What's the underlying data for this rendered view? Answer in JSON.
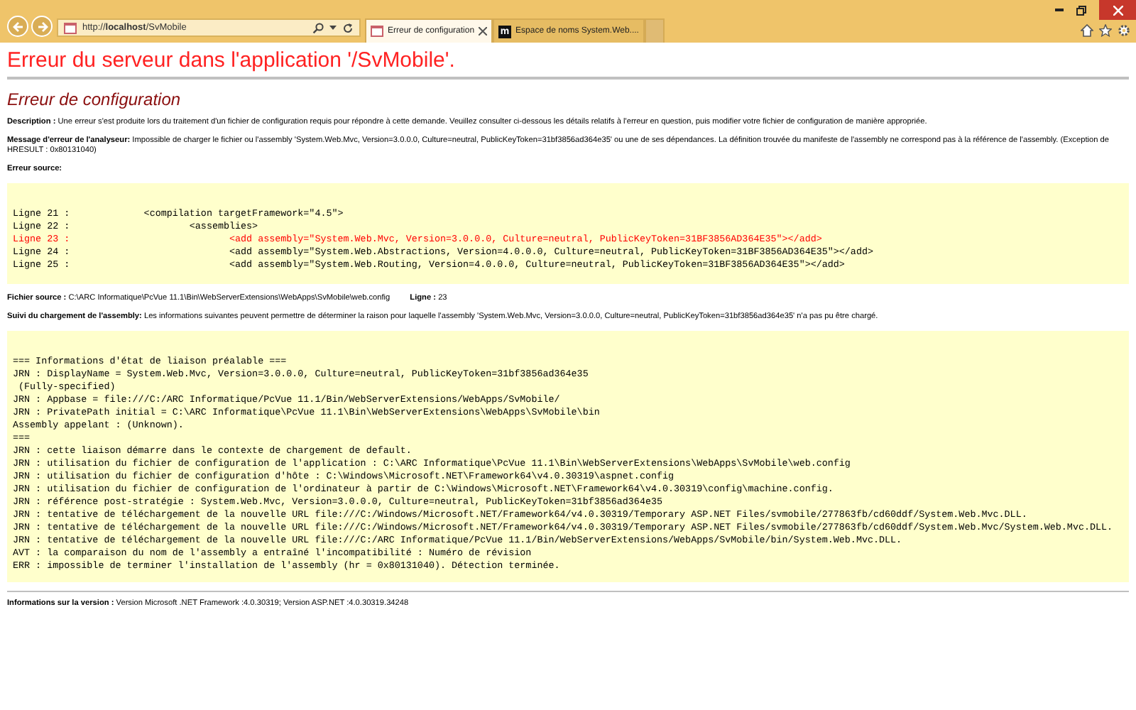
{
  "browser": {
    "address": "http://**localhost**/SvMobile",
    "tabs": [
      {
        "title": "Erreur de configuration",
        "selected": true
      },
      {
        "title": "Espace de noms System.Web....",
        "selected": false,
        "badge": "m"
      }
    ]
  },
  "page": {
    "title": "Erreur du serveur dans l'application '/SvMobile'.",
    "subtitle": "Erreur de configuration",
    "description": "**Description :** Une erreur s'est produite lors du traitement d'un fichier de configuration requis pour répondre à cette demande. Veuillez consulter ci-dessous les détails relatifs à l'erreur en question, puis modifier votre fichier de configuration de manière appropriée.",
    "parser_message": "**Message d'erreur de l'analyseur:** Impossible de charger le fichier ou l'assembly 'System.Web.Mvc, Version=3.0.0.0, Culture=neutral, PublicKeyToken=31bf3856ad364e35' ou une de ses dépendances. La définition trouvée du manifeste de l'assembly ne correspond pas à la référence de l'assembly. (Exception de HRESULT : 0x80131040)",
    "source_error_label": "Erreur source:",
    "source_lines": [
      {
        "text": "Ligne 21 :             <compilation targetFramework=\"4.5\">",
        "highlighted": false
      },
      {
        "text": "Ligne 22 :                     <assemblies>",
        "highlighted": false
      },
      {
        "text": "Ligne 23 :                            <add assembly=\"System.Web.Mvc, Version=3.0.0.0, Culture=neutral, PublicKeyToken=31BF3856AD364E35\"></add>",
        "highlighted": true
      },
      {
        "text": "Ligne 24 :                            <add assembly=\"System.Web.Abstractions, Version=4.0.0.0, Culture=neutral, PublicKeyToken=31BF3856AD364E35\"></add>",
        "highlighted": false
      },
      {
        "text": "Ligne 25 :                            <add assembly=\"System.Web.Routing, Version=4.0.0.0, Culture=neutral, PublicKeyToken=31BF3856AD364E35\"></add>",
        "highlighted": false
      }
    ],
    "source_file": "**Fichier source :** C:\\ARC Informatique\\PcVue 11.1\\Bin\\WebServerExtensions\\WebApps\\SvMobile\\web.config",
    "source_line": "**Ligne :** 23",
    "trace_intro": "**Suivi du chargement de l'assembly:** Les informations suivantes peuvent permettre de déterminer la raison pour laquelle l'assembly 'System.Web.Mvc, Version=3.0.0.0, Culture=neutral, PublicKeyToken=31bf3856ad364e35' n'a pas pu être chargé.",
    "trace_lines": [
      "=== Informations d'état de liaison préalable ===",
      "JRN : DisplayName = System.Web.Mvc, Version=3.0.0.0, Culture=neutral, PublicKeyToken=31bf3856ad364e35",
      " (Fully-specified)",
      "JRN : Appbase = file:///C:/ARC Informatique/PcVue 11.1/Bin/WebServerExtensions/WebApps/SvMobile/",
      "JRN : PrivatePath initial = C:\\ARC Informatique\\PcVue 11.1\\Bin\\WebServerExtensions\\WebApps\\SvMobile\\bin",
      "Assembly appelant : (Unknown).",
      "===",
      "JRN : cette liaison démarre dans le contexte de chargement de default.",
      "JRN : utilisation du fichier de configuration de l'application : C:\\ARC Informatique\\PcVue 11.1\\Bin\\WebServerExtensions\\WebApps\\SvMobile\\web.config",
      "JRN : utilisation du fichier de configuration d'hôte : C:\\Windows\\Microsoft.NET\\Framework64\\v4.0.30319\\aspnet.config",
      "JRN : utilisation du fichier de configuration de l'ordinateur à partir de C:\\Windows\\Microsoft.NET\\Framework64\\v4.0.30319\\config\\machine.config.",
      "JRN : référence post-stratégie : System.Web.Mvc, Version=3.0.0.0, Culture=neutral, PublicKeyToken=31bf3856ad364e35",
      "JRN : tentative de téléchargement de la nouvelle URL file:///C:/Windows/Microsoft.NET/Framework64/v4.0.30319/Temporary ASP.NET Files/svmobile/277863fb/cd60ddf/System.Web.Mvc.DLL.",
      "JRN : tentative de téléchargement de la nouvelle URL file:///C:/Windows/Microsoft.NET/Framework64/v4.0.30319/Temporary ASP.NET Files/svmobile/277863fb/cd60ddf/System.Web.Mvc/System.Web.Mvc.DLL.",
      "JRN : tentative de téléchargement de la nouvelle URL file:///C:/ARC Informatique/PcVue 11.1/Bin/WebServerExtensions/WebApps/SvMobile/bin/System.Web.Mvc.DLL.",
      "AVT : la comparaison du nom de l'assembly a entraîné l'incompatibilité : Numéro de révision",
      "ERR : impossible de terminer l'installation de l'assembly (hr = 0x80131040). Détection terminée."
    ],
    "version": "**Informations sur la version :** Version Microsoft .NET Framework :4.0.30319; Version ASP.NET :4.0.30319.34248"
  }
}
